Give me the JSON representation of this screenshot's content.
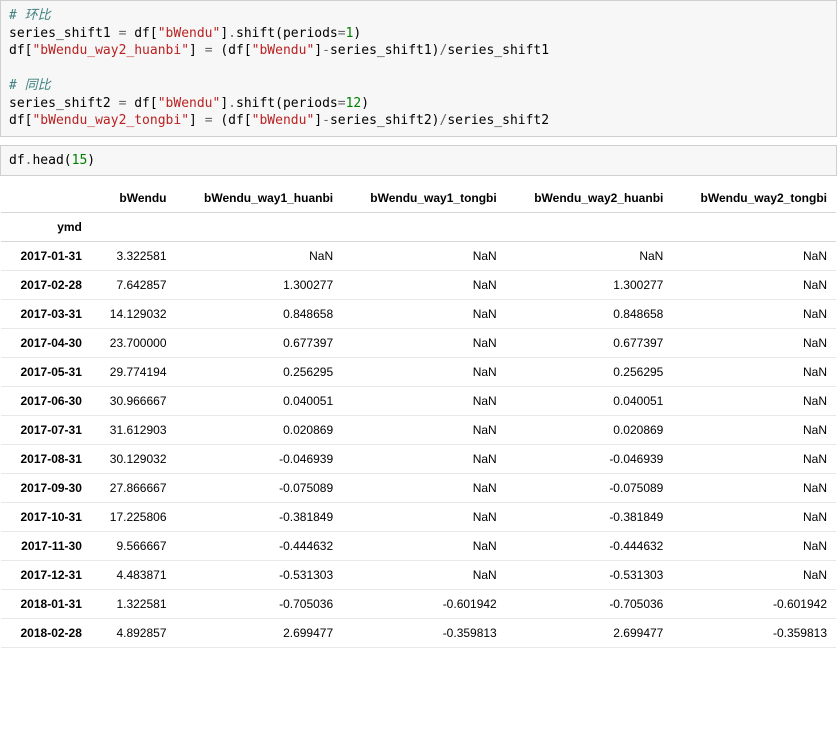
{
  "code_cell_1": {
    "comment1": "# 环比",
    "l1_a": "series_shift1 ",
    "l1_eq": "=",
    "l1_b": " df[",
    "l1_s1": "\"bWendu\"",
    "l1_c": "]",
    "l1_dot": ".",
    "l1_d": "shift(periods",
    "l1_eq2": "=",
    "l1_n1": "1",
    "l1_e": ")",
    "l2_a": "df[",
    "l2_s1": "\"bWendu_way2_huanbi\"",
    "l2_b": "] ",
    "l2_eq": "=",
    "l2_c": " (df[",
    "l2_s2": "\"bWendu\"",
    "l2_d": "]",
    "l2_op": "-",
    "l2_e": "series_shift1)",
    "l2_op2": "/",
    "l2_f": "series_shift1",
    "comment2": "# 同比",
    "l3_a": "series_shift2 ",
    "l3_eq": "=",
    "l3_b": " df[",
    "l3_s1": "\"bWendu\"",
    "l3_c": "]",
    "l3_dot": ".",
    "l3_d": "shift(periods",
    "l3_eq2": "=",
    "l3_n1": "12",
    "l3_e": ")",
    "l4_a": "df[",
    "l4_s1": "\"bWendu_way2_tongbi\"",
    "l4_b": "] ",
    "l4_eq": "=",
    "l4_c": " (df[",
    "l4_s2": "\"bWendu\"",
    "l4_d": "]",
    "l4_op": "-",
    "l4_e": "series_shift2)",
    "l4_op2": "/",
    "l4_f": "series_shift2"
  },
  "code_cell_2": {
    "a": "df",
    "dot": ".",
    "b": "head(",
    "n": "15",
    "c": ")"
  },
  "table": {
    "index_name": "ymd",
    "columns": [
      "bWendu",
      "bWendu_way1_huanbi",
      "bWendu_way1_tongbi",
      "bWendu_way2_huanbi",
      "bWendu_way2_tongbi"
    ],
    "rows": [
      {
        "idx": "2017-01-31",
        "c": [
          "3.322581",
          "NaN",
          "NaN",
          "NaN",
          "NaN"
        ]
      },
      {
        "idx": "2017-02-28",
        "c": [
          "7.642857",
          "1.300277",
          "NaN",
          "1.300277",
          "NaN"
        ]
      },
      {
        "idx": "2017-03-31",
        "c": [
          "14.129032",
          "0.848658",
          "NaN",
          "0.848658",
          "NaN"
        ]
      },
      {
        "idx": "2017-04-30",
        "c": [
          "23.700000",
          "0.677397",
          "NaN",
          "0.677397",
          "NaN"
        ]
      },
      {
        "idx": "2017-05-31",
        "c": [
          "29.774194",
          "0.256295",
          "NaN",
          "0.256295",
          "NaN"
        ]
      },
      {
        "idx": "2017-06-30",
        "c": [
          "30.966667",
          "0.040051",
          "NaN",
          "0.040051",
          "NaN"
        ]
      },
      {
        "idx": "2017-07-31",
        "c": [
          "31.612903",
          "0.020869",
          "NaN",
          "0.020869",
          "NaN"
        ]
      },
      {
        "idx": "2017-08-31",
        "c": [
          "30.129032",
          "-0.046939",
          "NaN",
          "-0.046939",
          "NaN"
        ]
      },
      {
        "idx": "2017-09-30",
        "c": [
          "27.866667",
          "-0.075089",
          "NaN",
          "-0.075089",
          "NaN"
        ]
      },
      {
        "idx": "2017-10-31",
        "c": [
          "17.225806",
          "-0.381849",
          "NaN",
          "-0.381849",
          "NaN"
        ]
      },
      {
        "idx": "2017-11-30",
        "c": [
          "9.566667",
          "-0.444632",
          "NaN",
          "-0.444632",
          "NaN"
        ]
      },
      {
        "idx": "2017-12-31",
        "c": [
          "4.483871",
          "-0.531303",
          "NaN",
          "-0.531303",
          "NaN"
        ]
      },
      {
        "idx": "2018-01-31",
        "c": [
          "1.322581",
          "-0.705036",
          "-0.601942",
          "-0.705036",
          "-0.601942"
        ]
      },
      {
        "idx": "2018-02-28",
        "c": [
          "4.892857",
          "2.699477",
          "-0.359813",
          "2.699477",
          "-0.359813"
        ]
      }
    ]
  }
}
